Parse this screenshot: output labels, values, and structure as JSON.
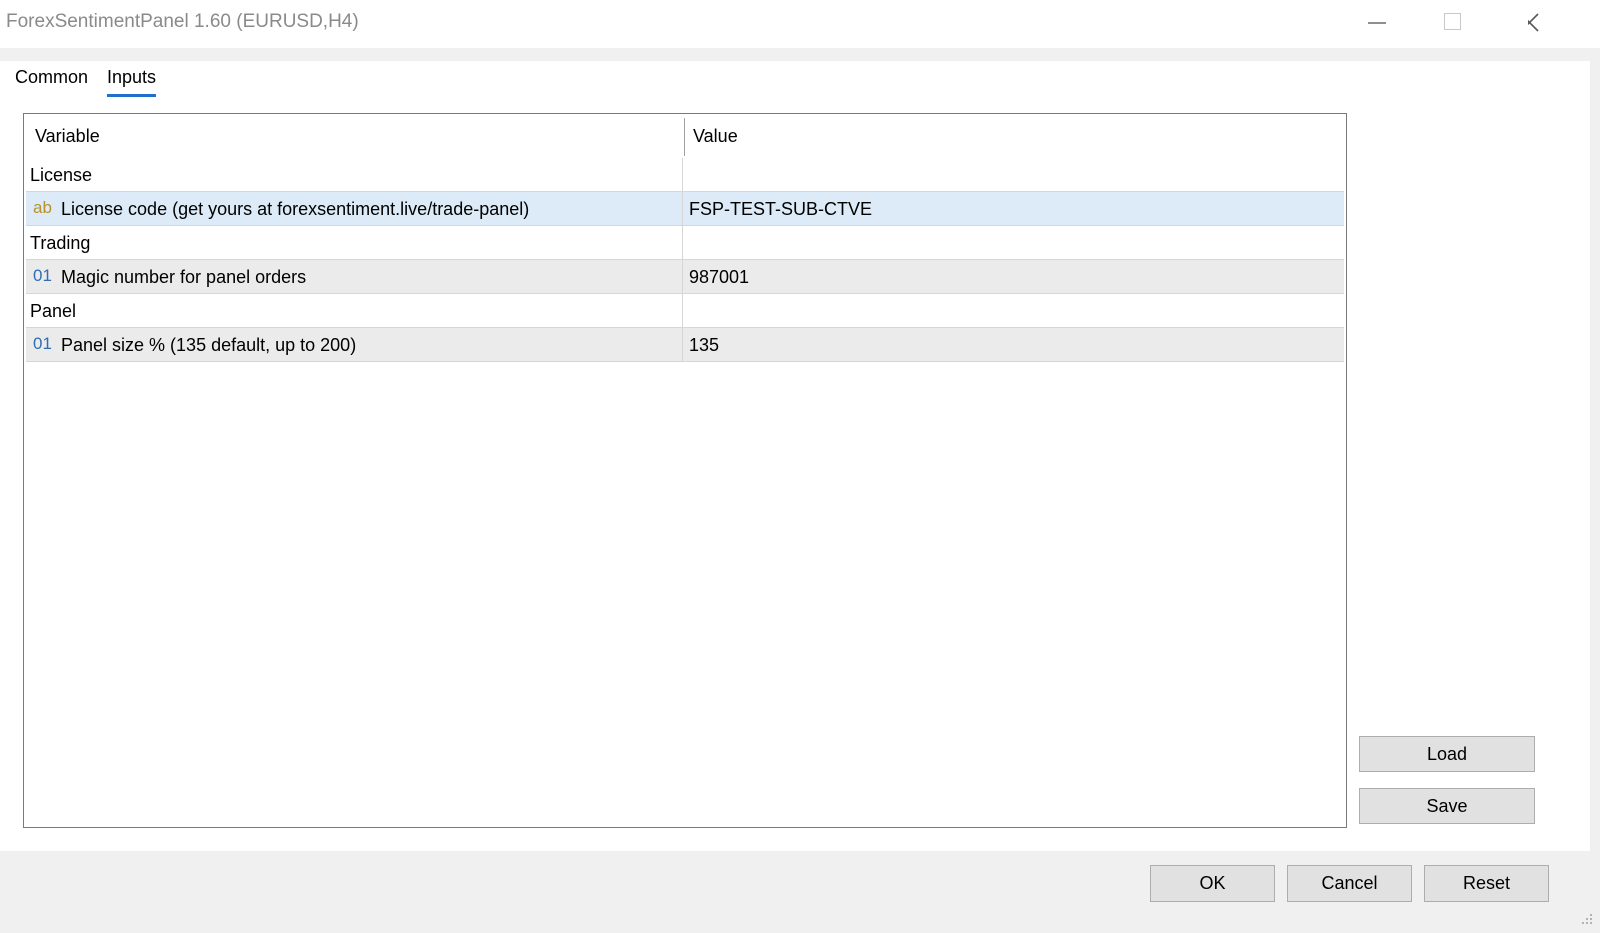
{
  "window": {
    "title": "ForexSentimentPanel 1.60 (EURUSD,H4)",
    "controls": [
      "minimize-icon",
      "maximize-icon",
      "close-icon"
    ]
  },
  "tabs": [
    {
      "label": "Common",
      "active": false
    },
    {
      "label": "Inputs",
      "active": true
    }
  ],
  "grid": {
    "headers": {
      "variable": "Variable",
      "value": "Value"
    },
    "groups": [
      {
        "label": "License",
        "params": [
          {
            "type_icon": "ab",
            "name": "License code (get yours at forexsentiment.live/trade-panel)",
            "value": "FSP-TEST-SUB-CTVE",
            "selected": true
          }
        ]
      },
      {
        "label": "Trading",
        "params": [
          {
            "type_icon": "01",
            "name": "Magic number for panel orders",
            "value": "987001",
            "selected": false
          }
        ]
      },
      {
        "label": "Panel",
        "params": [
          {
            "type_icon": "01",
            "name": "Panel size % (135 default, up to 200)",
            "value": "135",
            "selected": false
          }
        ]
      }
    ]
  },
  "side_buttons": {
    "load": "Load",
    "save": "Save"
  },
  "footer_buttons": {
    "ok": "OK",
    "cancel": "Cancel",
    "reset": "Reset"
  },
  "colors": {
    "tab_underline": "#1f6fd0",
    "selected_row": "#dcebf7",
    "param_row": "#ebebeb",
    "string_icon": "#b8912a",
    "int_icon": "#2f6db5"
  }
}
